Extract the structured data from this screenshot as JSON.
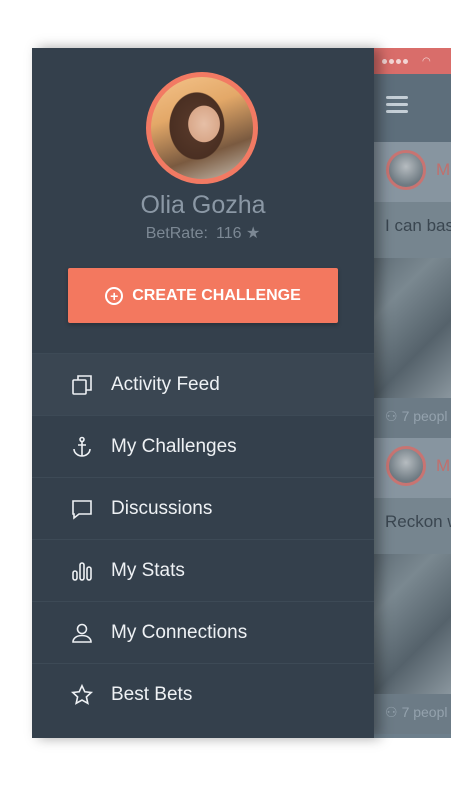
{
  "background_feed": {
    "card1": {
      "initial": "M",
      "text": "I can bas",
      "people": "7 peopl"
    },
    "card2": {
      "initial": "M",
      "text": "Reckon w",
      "people": "7 peopl"
    }
  },
  "profile": {
    "name": "Olia Gozha",
    "betrate_label": "BetRate:",
    "betrate_value": "116 ★"
  },
  "create_button": {
    "label": "CREATE CHALLENGE"
  },
  "menu": [
    {
      "label": "Activity Feed",
      "icon": "copy-icon"
    },
    {
      "label": "My Challenges",
      "icon": "anchor-icon"
    },
    {
      "label": "Discussions",
      "icon": "chat-icon"
    },
    {
      "label": "My Stats",
      "icon": "stats-icon"
    },
    {
      "label": "My Connections",
      "icon": "user-icon"
    },
    {
      "label": "Best Bets",
      "icon": "star-icon"
    }
  ],
  "colors": {
    "drawer_bg": "#34404c",
    "accent": "#f3785f",
    "text_light": "#eef1f4",
    "text_muted": "#8b98a5"
  }
}
